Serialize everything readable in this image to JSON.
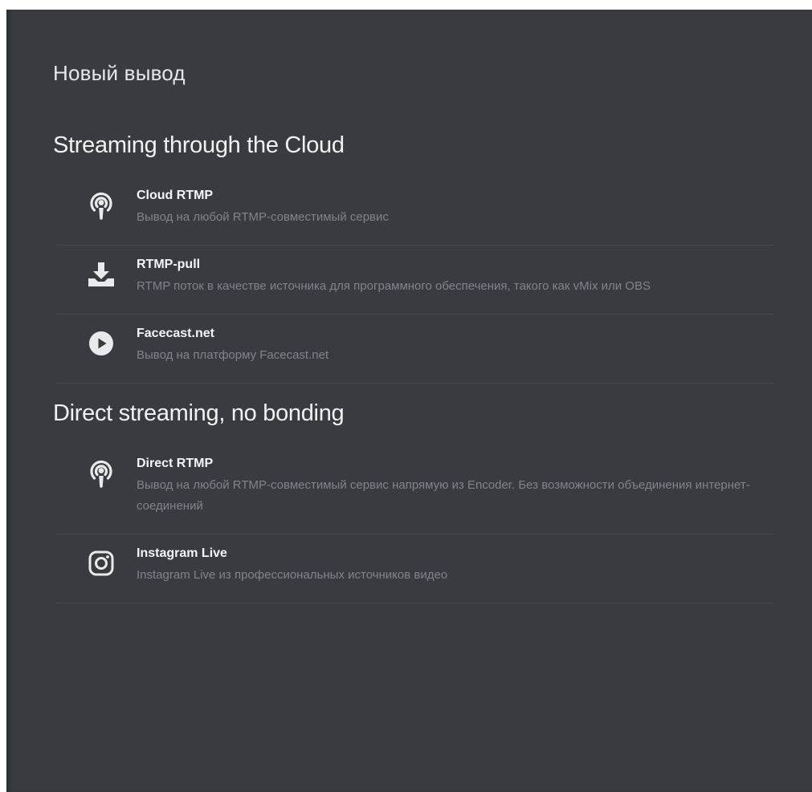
{
  "dialog": {
    "title": "Новый вывод"
  },
  "sections": [
    {
      "title": "Streaming through the Cloud",
      "items": [
        {
          "name": "Cloud RTMP",
          "description": "Вывод на любой RTMP-совместимый сервис",
          "icon": "podcast-icon"
        },
        {
          "name": "RTMP-pull",
          "description": "RTMP поток в качестве источника для программного обеспечения, такого как vMix или OBS",
          "icon": "download-icon"
        },
        {
          "name": "Facecast.net",
          "description": "Вывод на платформу Facecast.net",
          "icon": "play-circle-icon"
        }
      ]
    },
    {
      "title": "Direct streaming, no bonding",
      "items": [
        {
          "name": "Direct RTMP",
          "description": "Вывод на любой RTMP-совместимый сервис напрямую из Encoder. Без возможности объединения интернет-соединений",
          "icon": "podcast-icon"
        },
        {
          "name": "Instagram Live",
          "description": "Instagram Live из профессиональных источников видео",
          "icon": "instagram-icon"
        }
      ]
    }
  ],
  "colors": {
    "background": "#383b40",
    "text_primary": "#f4f5f6",
    "text_secondary": "#80848b",
    "divider": "#454850",
    "icon": "#e9eaec"
  }
}
